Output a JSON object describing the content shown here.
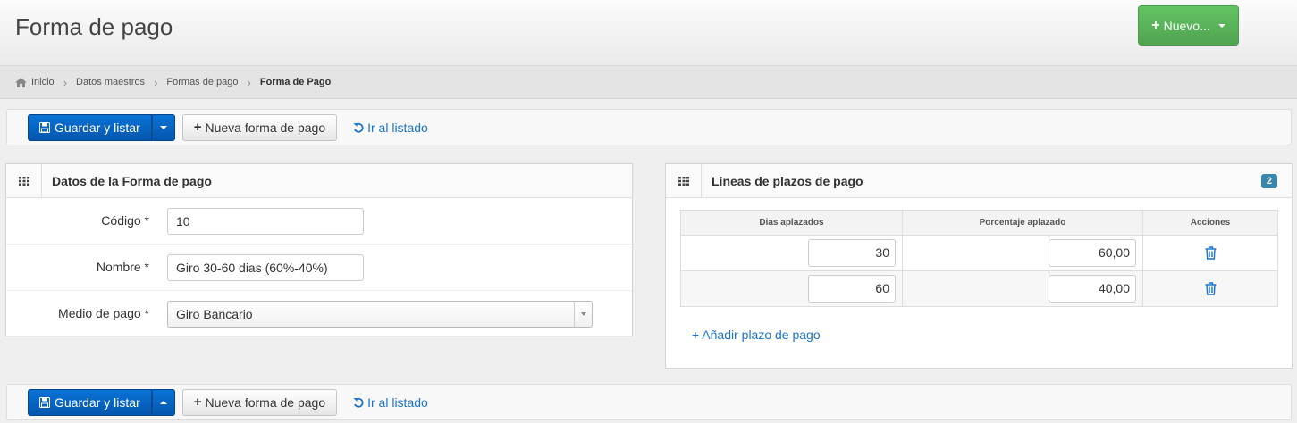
{
  "header": {
    "title": "Forma de pago",
    "new_button": "Nuevo..."
  },
  "breadcrumb": [
    "Inicio",
    "Datos maestros",
    "Formas de pago",
    "Forma de Pago"
  ],
  "toolbar": {
    "save_list": "Guardar y listar",
    "new_payment": "Nueva forma de pago",
    "go_list": "Ir al listado"
  },
  "datos": {
    "title": "Datos de la Forma de pago",
    "codigo_label": "Código *",
    "codigo_value": "10",
    "nombre_label": "Nombre *",
    "nombre_value": "Giro 30-60 dias (60%-40%)",
    "medio_label": "Medio de pago *",
    "medio_value": "Giro Bancario"
  },
  "plazos": {
    "title": "Lineas de plazos de pago",
    "count": "2",
    "columns": [
      "Dias aplazados",
      "Porcentaje aplazado",
      "Acciones"
    ],
    "rows": [
      {
        "dias": "30",
        "porcentaje": "60,00"
      },
      {
        "dias": "60",
        "porcentaje": "40,00"
      }
    ],
    "add_link": "+ Añadir plazo de pago"
  },
  "colors": {
    "primary": "#0557ad",
    "success": "#51a351",
    "link": "#1a73c6",
    "badge": "#3a87ad"
  },
  "icons": {
    "home": "home-icon",
    "save": "floppy-icon",
    "undo": "undo-icon",
    "grid": "grid-icon",
    "trash": "trash-icon"
  }
}
